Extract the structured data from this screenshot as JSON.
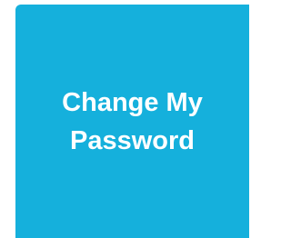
{
  "tile": {
    "label": "Change My Password",
    "background_color": "#15b0dc",
    "text_color": "#ffffff"
  }
}
